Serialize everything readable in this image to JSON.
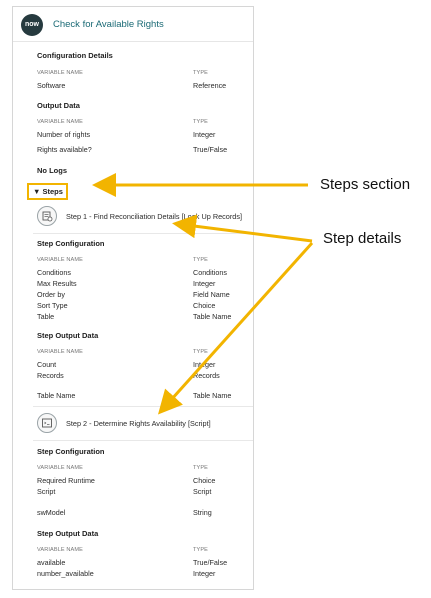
{
  "header": {
    "logo_text": "now",
    "title": "Check for Available Rights"
  },
  "configuration_details": {
    "heading": "Configuration Details",
    "col_variable": "VARIABLE NAME",
    "col_type": "TYPE",
    "rows": [
      {
        "name": "Software",
        "type": "Reference"
      }
    ]
  },
  "output_data": {
    "heading": "Output Data",
    "col_variable": "VARIABLE NAME",
    "col_type": "TYPE",
    "rows": [
      {
        "name": "Number of rights",
        "type": "Integer"
      },
      {
        "name": "Rights available?",
        "type": "True/False"
      }
    ]
  },
  "no_logs": "No Logs",
  "steps": {
    "toggle_label": "▼ Steps",
    "step1": {
      "label": "Step 1 - Find Reconciliation Details [Look Up Records]",
      "icon": "records-lookup-icon",
      "config_heading": "Step Configuration",
      "col_variable": "VARIABLE NAME",
      "col_type": "TYPE",
      "config_rows": [
        {
          "name": "Conditions",
          "type": "Conditions"
        },
        {
          "name": "Max Results",
          "type": "Integer"
        },
        {
          "name": "Order by",
          "type": "Field Name"
        },
        {
          "name": "Sort Type",
          "type": "Choice"
        },
        {
          "name": "Table",
          "type": "Table Name"
        }
      ],
      "output_heading": "Step Output Data",
      "output_rows": [
        {
          "name": "Count",
          "type": "Integer"
        },
        {
          "name": "Records",
          "type": "Records"
        },
        {
          "name": "Table Name",
          "type": "Table Name"
        }
      ]
    },
    "step2": {
      "label": "Step 2 - Determine Rights Availability [Script]",
      "icon": "script-icon",
      "config_heading": "Step Configuration",
      "col_variable": "VARIABLE NAME",
      "col_type": "TYPE",
      "config_rows": [
        {
          "name": "Required Runtime",
          "type": "Choice"
        },
        {
          "name": "Script",
          "type": "Script"
        },
        {
          "name": "swModel",
          "type": "String"
        }
      ],
      "output_heading": "Step Output Data",
      "output_rows": [
        {
          "name": "available",
          "type": "True/False"
        },
        {
          "name": "number_available",
          "type": "Integer"
        }
      ]
    }
  },
  "annotations": {
    "steps_section": "Steps section",
    "step_details": "Step details",
    "highlight_color": "#F2B400"
  }
}
